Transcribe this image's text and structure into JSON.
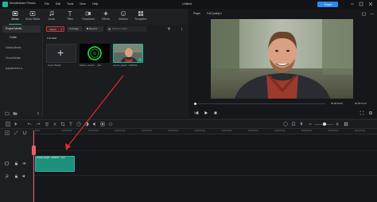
{
  "app": {
    "title": "Wondershare Filmora",
    "project": "Untitled",
    "menu": [
      "File",
      "Edit",
      "Tools",
      "View",
      "Help"
    ],
    "export_label": "Export"
  },
  "media_tabs": [
    {
      "label": "Media",
      "icon": "media-icon"
    },
    {
      "label": "Stock Media",
      "icon": "stock-media-icon"
    },
    {
      "label": "Audio",
      "icon": "music-note-icon"
    },
    {
      "label": "Titles",
      "icon": "text-icon"
    },
    {
      "label": "Transitions",
      "icon": "transitions-icon"
    },
    {
      "label": "Effects",
      "icon": "effects-icon"
    },
    {
      "label": "Stickers",
      "icon": "stickers-icon"
    },
    {
      "label": "Templates",
      "icon": "templates-icon"
    }
  ],
  "sidebar": {
    "items": [
      {
        "label": "Project Media",
        "active": true
      },
      {
        "label": "Global Media",
        "active": false
      },
      {
        "label": "Cloud Media",
        "active": false
      },
      {
        "label": "Adjustment La...",
        "active": false
      }
    ],
    "folder_label": "Folder"
  },
  "media": {
    "import_button": "Import",
    "ai_image_button": "AI Image",
    "record_button": "Record",
    "search_placeholder": "Search media",
    "folder_heading": "FOLDER",
    "items": [
      {
        "name": "Import Media"
      },
      {
        "name": "Sphere_Gumm..._Wh..."
      },
      {
        "name": "people_laughi...3240011..."
      }
    ]
  },
  "player": {
    "label": "Player",
    "quality": "Full Quality",
    "time_current": "00:00:00:00",
    "time_total": "00:00:13:12"
  },
  "timeline": {
    "ruler_ticks": [
      "00:00",
      "00:00:05:00",
      "00:00:10:00",
      "00:00:15:00",
      "00:00:20:00",
      "00:00:25:00",
      "00:00:30:00",
      "00:00:35:00",
      "00:00:40:00",
      "00:00:45:00",
      "00:00:50:00",
      "00:00:55:00",
      "00:01:00:00"
    ],
    "clip_label": "people_laughi...3240011...mp4"
  },
  "colors": {
    "accent": "#1fb8a0",
    "import_highlight": "#e02b2b",
    "annotation_arrow": "#e02b2b",
    "playhead": "#f05a6a",
    "clip": "#1d8f7d",
    "export": "#2b8af5"
  }
}
